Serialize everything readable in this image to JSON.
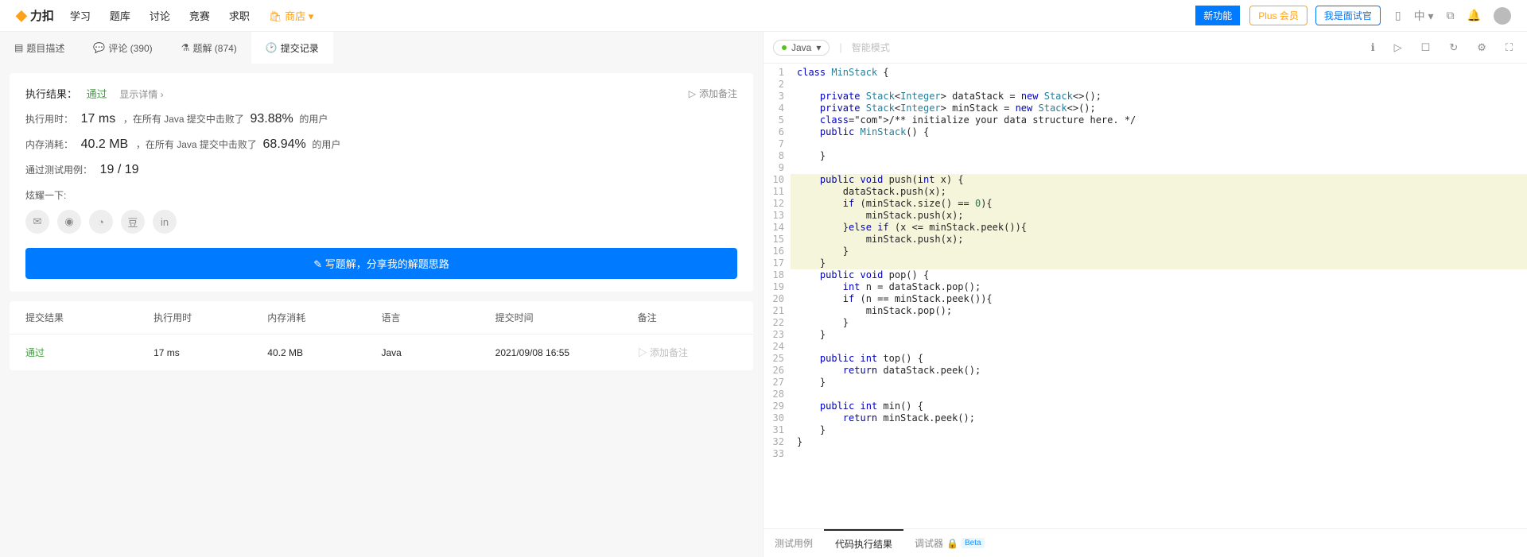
{
  "nav": {
    "brand": "力扣",
    "items": [
      "学习",
      "题库",
      "讨论",
      "竞赛",
      "求职"
    ],
    "shop": "商店",
    "new_feature": "新功能",
    "plus": "Plus 会员",
    "interview": "我是面试官",
    "lang": "中"
  },
  "tabs": {
    "desc": "题目描述",
    "comments": "评论 (390)",
    "solutions": "题解 (874)",
    "submissions": "提交记录"
  },
  "result": {
    "label": "执行结果：",
    "status": "通过",
    "detail": "显示详情 ›",
    "add_note": "添加备注",
    "runtime_label": "执行用时：",
    "runtime_val": "17 ms",
    "runtime_text1": "，在所有 Java 提交中击败了",
    "runtime_pct": "93.88%",
    "runtime_text2": "的用户",
    "memory_label": "内存消耗：",
    "memory_val": "40.2 MB",
    "memory_text1": "，在所有 Java 提交中击败了",
    "memory_pct": "68.94%",
    "memory_text2": "的用户",
    "testcase_label": "通过测试用例：",
    "testcase_val": "19 / 19",
    "boast": "炫耀一下:",
    "write_solution": "✎ 写题解，分享我的解题思路"
  },
  "table": {
    "h1": "提交结果",
    "h2": "执行用时",
    "h3": "内存消耗",
    "h4": "语言",
    "h5": "提交时间",
    "h6": "备注",
    "r1": "通过",
    "r2": "17 ms",
    "r3": "40.2 MB",
    "r4": "Java",
    "r5": "2021/09/08 16:55",
    "r6": "添加备注"
  },
  "editor": {
    "lang": "Java",
    "smart": "智能模式",
    "lines": [
      "class MinStack {",
      "",
      "    private Stack<Integer> dataStack = new Stack<>();",
      "    private Stack<Integer> minStack = new Stack<>();",
      "    /** initialize your data structure here. */",
      "    public MinStack() {",
      "",
      "    }",
      "",
      "    public void push(int x) {",
      "        dataStack.push(x);",
      "        if (minStack.size() == 0){",
      "            minStack.push(x);",
      "        }else if (x <= minStack.peek()){",
      "            minStack.push(x);",
      "        }",
      "    }",
      "    public void pop() {",
      "        int n = dataStack.pop();",
      "        if (n == minStack.peek()){",
      "            minStack.pop();",
      "        }",
      "    }",
      "",
      "    public int top() {",
      "        return dataStack.peek();",
      "    }",
      "",
      "    public int min() {",
      "        return minStack.peek();",
      "    }",
      "}",
      ""
    ],
    "highlighted": [
      10,
      11,
      12,
      13,
      14,
      15,
      16,
      17
    ]
  },
  "bottom_tabs": {
    "test": "测试用例",
    "result": "代码执行结果",
    "debugger": "调试器",
    "beta": "Beta"
  }
}
